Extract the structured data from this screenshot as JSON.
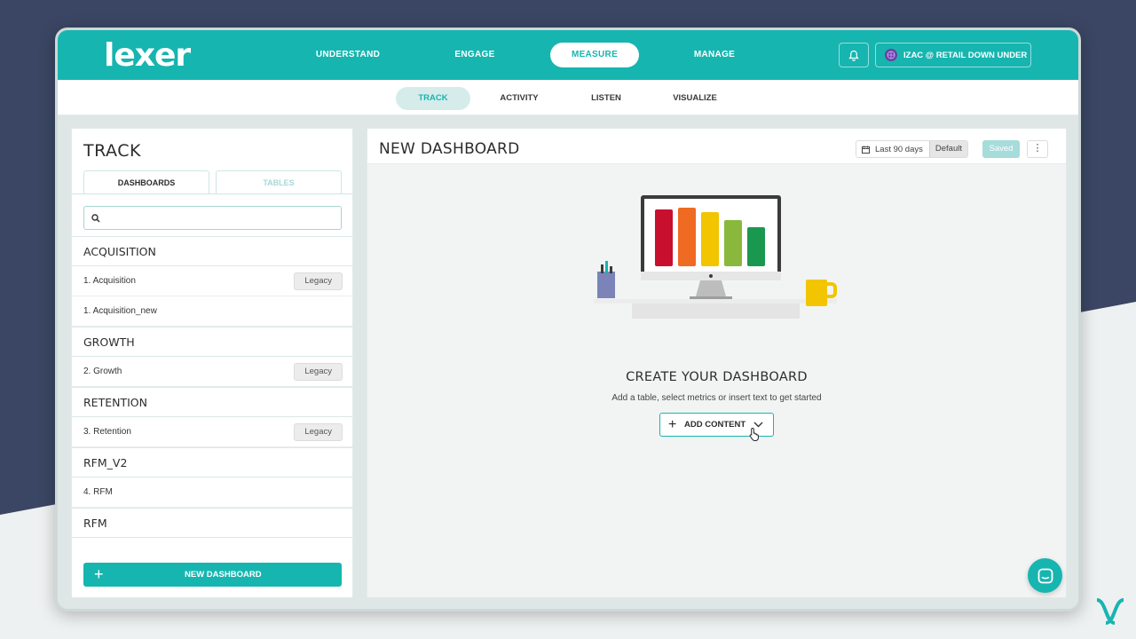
{
  "app": {
    "logo": "lexer"
  },
  "topnav": {
    "items": [
      {
        "label": "UNDERSTAND"
      },
      {
        "label": "ENGAGE"
      },
      {
        "label": "MEASURE"
      },
      {
        "label": "MANAGE"
      }
    ],
    "active": "MEASURE",
    "user_label": "IZAC @ RETAIL DOWN UNDER"
  },
  "subnav": {
    "tabs": [
      {
        "label": "TRACK"
      },
      {
        "label": "ACTIVITY"
      },
      {
        "label": "LISTEN"
      },
      {
        "label": "VISUALIZE"
      }
    ],
    "active": "TRACK"
  },
  "sidebar": {
    "title": "TRACK",
    "tabs": [
      {
        "label": "DASHBOARDS"
      },
      {
        "label": "TABLES"
      }
    ],
    "search_placeholder": "",
    "groups": [
      {
        "name": "ACQUISITION",
        "items": [
          {
            "label": "1. Acquisition",
            "badge": "Legacy"
          },
          {
            "label": "1. Acquisition_new",
            "badge": ""
          }
        ]
      },
      {
        "name": "GROWTH",
        "items": [
          {
            "label": "2. Growth",
            "badge": "Legacy"
          }
        ]
      },
      {
        "name": "RETENTION",
        "items": [
          {
            "label": "3. Retention",
            "badge": "Legacy"
          }
        ]
      },
      {
        "name": "RFM_V2",
        "items": [
          {
            "label": "4. RFM",
            "badge": ""
          }
        ]
      },
      {
        "name": "RFM",
        "items": []
      }
    ],
    "new_dashboard_label": "NEW DASHBOARD"
  },
  "main": {
    "title": "NEW DASHBOARD",
    "date_range": "Last 90 days",
    "default_label": "Default",
    "saved_label": "Saved",
    "empty_title": "CREATE YOUR DASHBOARD",
    "empty_subtitle": "Add a table, select metrics or insert text to get started",
    "add_content_label": "ADD CONTENT"
  },
  "colors": {
    "brand": "#17b5b0",
    "page_bg": "#3a4663",
    "bars": [
      "#c8102e",
      "#ef6a23",
      "#f2c500",
      "#8ab83c",
      "#1a9850"
    ]
  }
}
